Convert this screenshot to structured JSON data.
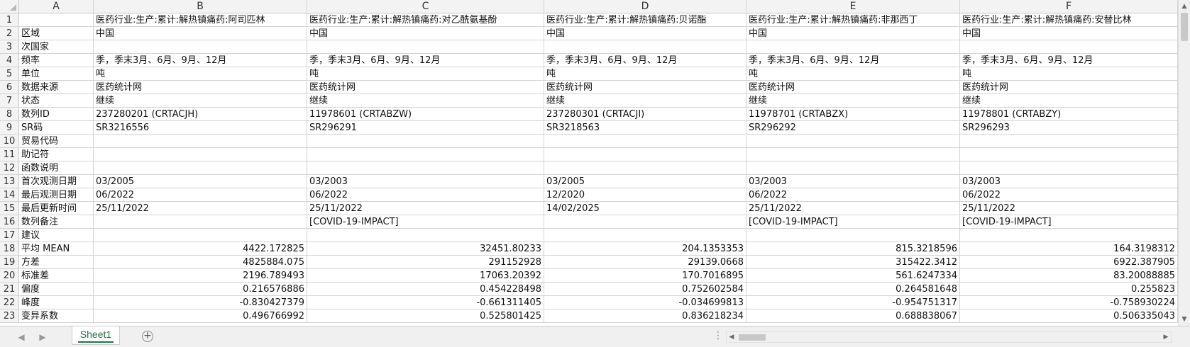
{
  "columns": [
    "A",
    "B",
    "C",
    "D",
    "E",
    "F"
  ],
  "rows": [
    {
      "n": "1",
      "a": "",
      "b": "医药行业:生产:累计:解热镇痛药:阿司匹林",
      "c": "医药行业:生产:累计:解热镇痛药:对乙酰氨基酚",
      "d": "医药行业:生产:累计:解热镇痛药:贝诺酯",
      "e": "医药行业:生产:累计:解热镇痛药:非那西丁",
      "f": "医药行业:生产:累计:解热镇痛药:安替比林"
    },
    {
      "n": "2",
      "a": "区域",
      "b": "中国",
      "c": "中国",
      "d": "中国",
      "e": "中国",
      "f": "中国"
    },
    {
      "n": "3",
      "a": "次国家",
      "b": "",
      "c": "",
      "d": "",
      "e": "",
      "f": ""
    },
    {
      "n": "4",
      "a": "频率",
      "b": "季，季末3月、6月、9月、12月",
      "c": "季，季末3月、6月、9月、12月",
      "d": "季，季末3月、6月、9月、12月",
      "e": "季，季末3月、6月、9月、12月",
      "f": "季，季末3月、6月、9月、12月"
    },
    {
      "n": "5",
      "a": "单位",
      "b": "吨",
      "c": "吨",
      "d": "吨",
      "e": "吨",
      "f": "吨"
    },
    {
      "n": "6",
      "a": "数据来源",
      "b": "医药统计网",
      "c": "医药统计网",
      "d": "医药统计网",
      "e": "医药统计网",
      "f": "医药统计网"
    },
    {
      "n": "7",
      "a": "状态",
      "b": "继续",
      "c": "继续",
      "d": "继续",
      "e": "继续",
      "f": "继续"
    },
    {
      "n": "8",
      "a": "数列ID",
      "b": "237280201 (CRTACJH)",
      "c": "11978601 (CRTABZW)",
      "d": "237280301 (CRTACJI)",
      "e": "11978701 (CRTABZX)",
      "f": "11978801 (CRTABZY)"
    },
    {
      "n": "9",
      "a": "SR码",
      "b": "SR3216556",
      "c": "SR296291",
      "d": "SR3218563",
      "e": "SR296292",
      "f": "SR296293"
    },
    {
      "n": "10",
      "a": "贸易代码",
      "b": "",
      "c": "",
      "d": "",
      "e": "",
      "f": ""
    },
    {
      "n": "11",
      "a": "助记符",
      "b": "",
      "c": "",
      "d": "",
      "e": "",
      "f": ""
    },
    {
      "n": "12",
      "a": "函数说明",
      "b": "",
      "c": "",
      "d": "",
      "e": "",
      "f": ""
    },
    {
      "n": "13",
      "a": "首次观测日期",
      "b": "03/2005",
      "c": "03/2003",
      "d": "03/2005",
      "e": "03/2003",
      "f": "03/2003"
    },
    {
      "n": "14",
      "a": "最后观测日期",
      "b": "06/2022",
      "c": "06/2022",
      "d": "12/2020",
      "e": "06/2022",
      "f": "06/2022"
    },
    {
      "n": "15",
      "a": "最后更新时间",
      "b": "25/11/2022",
      "c": "25/11/2022",
      "d": "14/02/2025",
      "e": "25/11/2022",
      "f": "25/11/2022"
    },
    {
      "n": "16",
      "a": "数列备注",
      "b": "",
      "c": "[COVID-19-IMPACT]",
      "d": "",
      "e": "[COVID-19-IMPACT]",
      "f": "[COVID-19-IMPACT]"
    },
    {
      "n": "17",
      "a": "建议",
      "b": "",
      "c": "",
      "d": "",
      "e": "",
      "f": ""
    },
    {
      "n": "18",
      "a": "平均 MEAN",
      "b": "4422.172825",
      "c": "32451.80233",
      "d": "204.1353353",
      "e": "815.3218596",
      "f": "164.3198312",
      "num": true
    },
    {
      "n": "19",
      "a": "方差",
      "b": "4825884.075",
      "c": "291152928",
      "d": "29139.0668",
      "e": "315422.3412",
      "f": "6922.387905",
      "num": true
    },
    {
      "n": "20",
      "a": "标准差",
      "b": "2196.789493",
      "c": "17063.20392",
      "d": "170.7016895",
      "e": "561.6247334",
      "f": "83.20088885",
      "num": true
    },
    {
      "n": "21",
      "a": "偏度",
      "b": "0.216576886",
      "c": "0.454228498",
      "d": "0.752602584",
      "e": "0.264581648",
      "f": "0.255823",
      "num": true
    },
    {
      "n": "22",
      "a": "峰度",
      "b": "-0.830427379",
      "c": "-0.661311405",
      "d": "-0.034699813",
      "e": "-0.954751317",
      "f": "-0.758930224",
      "num": true
    },
    {
      "n": "23",
      "a": "变异系数",
      "b": "0.496766992",
      "c": "0.525801425",
      "d": "0.836218234",
      "e": "0.688838067",
      "f": "0.506335043",
      "num": true
    }
  ],
  "sheet_tab": "Sheet1",
  "add_sheet_glyph": "+",
  "more_glyph": "⋮",
  "nav_prev": "◀",
  "nav_next": "▶",
  "scroll_up": "▲",
  "scroll_down": "▼",
  "scroll_left": "◀",
  "scroll_right": "▶",
  "colors": {
    "accent": "#217346",
    "header_bg": "#f3f3f3",
    "grid": "#d4d4d4"
  }
}
